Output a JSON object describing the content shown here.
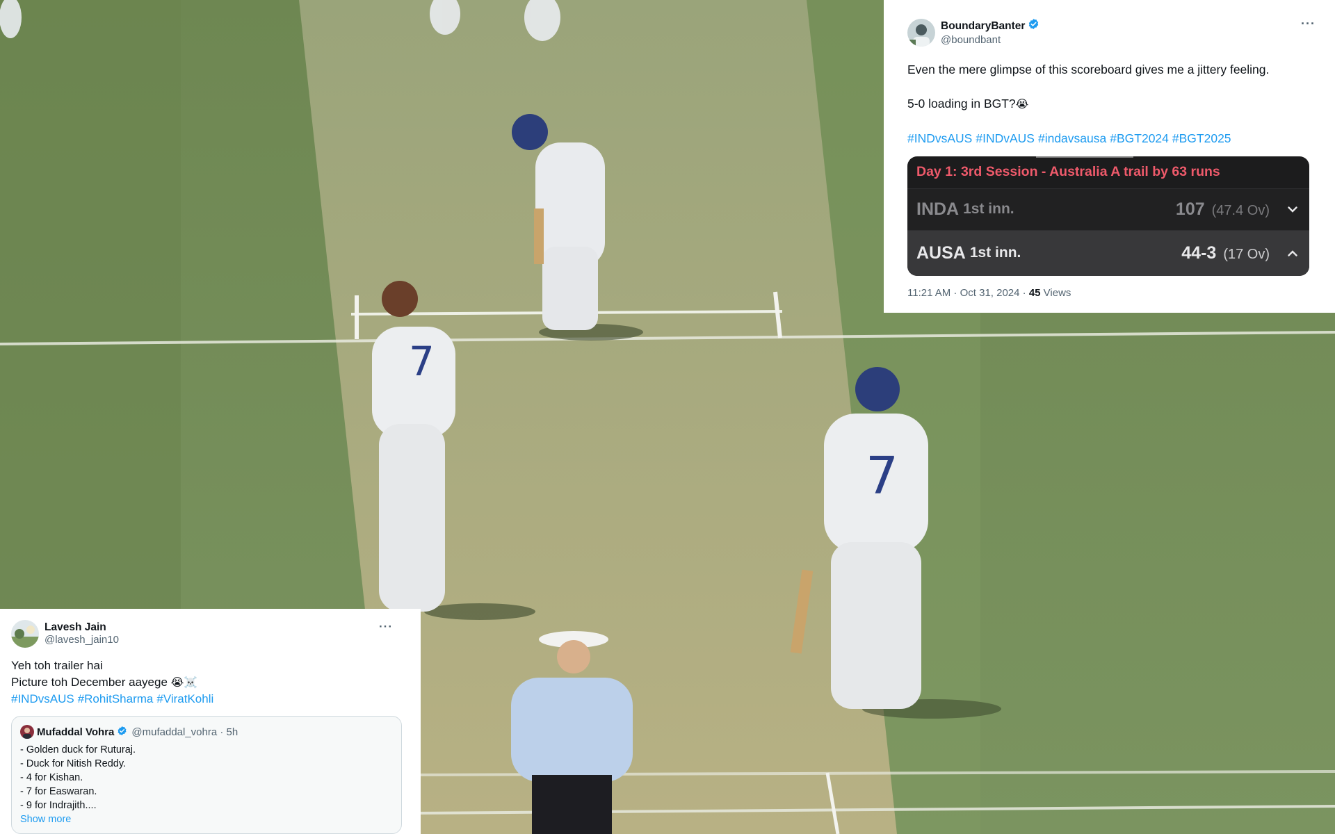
{
  "top_tweet": {
    "display_name": "BoundaryBanter",
    "handle": "@boundbant",
    "more_label": "···",
    "text_line_1": "Even the mere glimpse of this scoreboard gives me a jittery feeling.",
    "text_line_2": "5-0 loading in BGT?",
    "text_line_2_emoji": "😭",
    "hashtags": [
      "#INDvsAUS",
      "#INDvAUS",
      "#indavsausa",
      "#BGT2024",
      "#BGT2025"
    ],
    "scoreboard": {
      "title": "Day 1: 3rd Session - Australia A trail by 63 runs",
      "rows": [
        {
          "team": "INDA",
          "innings": "1st inn.",
          "score": "107",
          "overs": "(47.4 Ov)",
          "chevron": "chevron-down-icon"
        },
        {
          "team": "AUSA",
          "innings": "1st inn.",
          "score": "44-3",
          "overs": "(17 Ov)",
          "chevron": "chevron-up-icon"
        }
      ]
    },
    "timestamp": "11:21 AM · Oct 31, 2024 · ",
    "views_count": "45",
    "views_label": " Views"
  },
  "bottom_tweet": {
    "display_name": "Lavesh Jain",
    "handle": "@lavesh_jain10",
    "more_label": "···",
    "text_line_1": "Yeh toh trailer hai",
    "text_line_2": "Picture toh December aayege",
    "text_line_2_emoji": "😭☠️",
    "hashtags": [
      "#INDvsAUS",
      "#RohitSharma",
      "#ViratKohli"
    ],
    "quote": {
      "display_name": "Mufaddal Vohra",
      "handle_time": "@mufaddal_vohra · 5h",
      "lines": [
        "- Golden duck for Ruturaj.",
        "- Duck for Nitish Reddy.",
        "- 4 for Kishan.",
        "- 7 for Easwaran.",
        "- 9 for Indrajith...."
      ],
      "show_more": "Show more"
    }
  },
  "colors": {
    "link": "#1d9bf0",
    "verified": "#1d9bf0",
    "scoreboard_title": "#ef5a6b",
    "scoreboard_bg": "#1c1c1d"
  }
}
